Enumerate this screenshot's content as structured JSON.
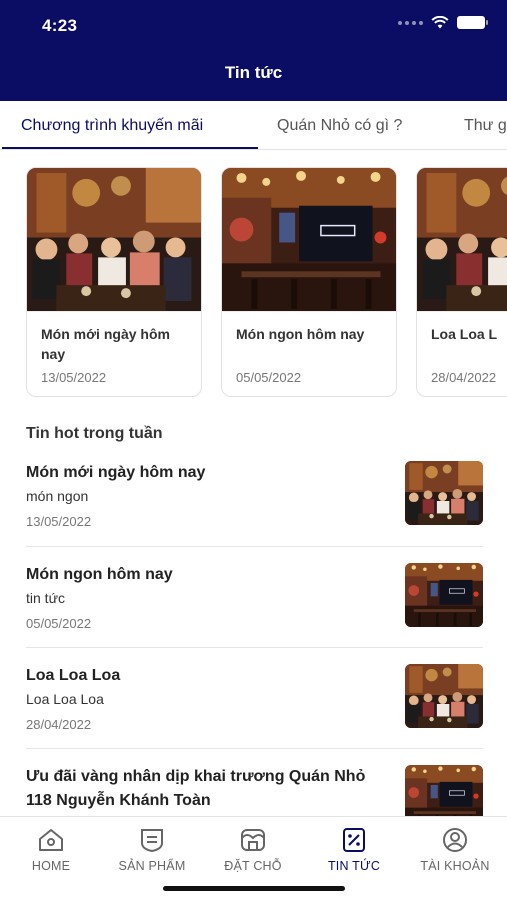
{
  "status_bar": {
    "time": "4:23"
  },
  "header": {
    "title": "Tin tức"
  },
  "tabs": [
    {
      "label": "Chương trình khuyến mãi",
      "active": true
    },
    {
      "label": "Quán Nhỏ có gì ?",
      "active": false
    },
    {
      "label": "Thư g",
      "active": false
    }
  ],
  "featured_cards": [
    {
      "title": "Món mới ngày hôm nay",
      "date": "13/05/2022",
      "image": "restaurant-crowd-photo"
    },
    {
      "title": "Món ngon hôm nay",
      "date": "05/05/2022",
      "image": "restaurant-interior-photo"
    },
    {
      "title": "Loa Loa L",
      "date": "28/04/2022",
      "image": "restaurant-crowd-photo"
    }
  ],
  "hot_section": {
    "title": "Tin hot trong tuần",
    "items": [
      {
        "title": "Món mới ngày hôm nay",
        "subtitle": "món ngon",
        "date": "13/05/2022",
        "image": "restaurant-crowd-photo"
      },
      {
        "title": "Món ngon hôm nay",
        "subtitle": "tin tức",
        "date": "05/05/2022",
        "image": "restaurant-interior-photo"
      },
      {
        "title": "Loa Loa Loa",
        "subtitle": "Loa Loa Loa",
        "date": "28/04/2022",
        "image": "restaurant-crowd-photo"
      },
      {
        "title": "Ưu đãi vàng nhân dịp khai trương Quán Nhỏ 118 Nguyễn Khánh Toàn",
        "subtitle": "",
        "date": "",
        "image": "restaurant-interior-photo"
      }
    ]
  },
  "bottom_nav": [
    {
      "label": "HOME",
      "icon": "home-icon",
      "active": false
    },
    {
      "label": "SẢN PHẨM",
      "icon": "product-icon",
      "active": false
    },
    {
      "label": "ĐẶT CHỖ",
      "icon": "booking-icon",
      "active": false
    },
    {
      "label": "TIN TỨC",
      "icon": "news-icon",
      "active": true
    },
    {
      "label": "TÀI KHOẢN",
      "icon": "account-icon",
      "active": false
    }
  ],
  "colors": {
    "primary": "#0b0c63",
    "text": "#222222",
    "muted": "#777777"
  }
}
